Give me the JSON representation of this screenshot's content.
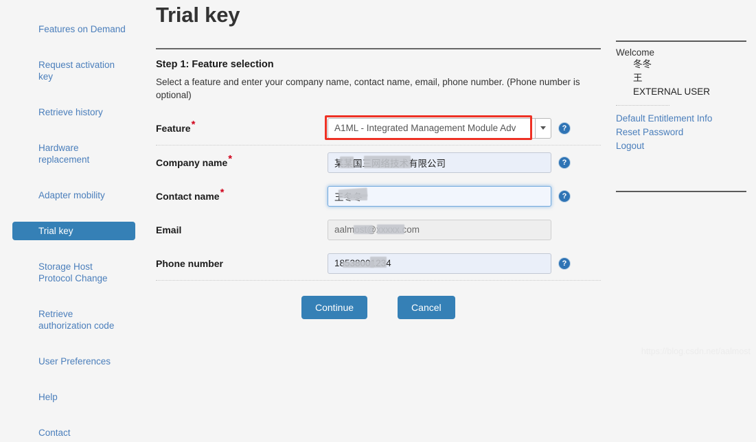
{
  "sidebar": {
    "items": [
      {
        "label": "Features on Demand",
        "active": false
      },
      {
        "label": "Request activation key",
        "active": false
      },
      {
        "label": "Retrieve history",
        "active": false
      },
      {
        "label": "Hardware replacement",
        "active": false
      },
      {
        "label": "Adapter mobility",
        "active": false
      },
      {
        "label": "Trial key",
        "active": true
      },
      {
        "label": "Storage Host Protocol Change",
        "active": false
      },
      {
        "label": "Retrieve authorization code",
        "active": false
      },
      {
        "label": "User Preferences",
        "active": false
      },
      {
        "label": "Help",
        "active": false
      },
      {
        "label": "Contact",
        "active": false
      }
    ],
    "active_bg": "#3580b6",
    "link_color": "#4a7ebb"
  },
  "main": {
    "title": "Trial key",
    "step_title": "Step 1: Feature selection",
    "step_description": "Select a feature and enter your company name, contact name, email, phone number. (Phone number is optional)",
    "fields": {
      "feature": {
        "label": "Feature",
        "required": true,
        "value": "A1ML - Integrated Management Module Adv",
        "highlight_color": "#ee3124",
        "help_icon": "question-mark-icon"
      },
      "company_name": {
        "label": "Company name",
        "required": true,
        "value": "某某国三网络技术有限公司",
        "help_icon": "question-mark-icon"
      },
      "contact_name": {
        "label": "Contact name",
        "required": true,
        "value": "王冬冬",
        "focused": true,
        "help_icon": "question-mark-icon"
      },
      "email": {
        "label": "Email",
        "required": false,
        "value": "aalmost@xxxxx.com",
        "disabled": true
      },
      "phone_number": {
        "label": "Phone number",
        "required": false,
        "value": "18538001234",
        "help_icon": "question-mark-icon"
      }
    },
    "buttons": {
      "continue": "Continue",
      "cancel": "Cancel",
      "color": "#3580b6"
    }
  },
  "right_panel": {
    "welcome": "Welcome",
    "user_first_name": "冬冬",
    "user_last_name": "王",
    "user_role": "EXTERNAL USER",
    "links": [
      "Default Entitlement Info",
      "Reset Password",
      "Logout"
    ]
  },
  "watermark": "https://blog.csdn.net/aalmost"
}
